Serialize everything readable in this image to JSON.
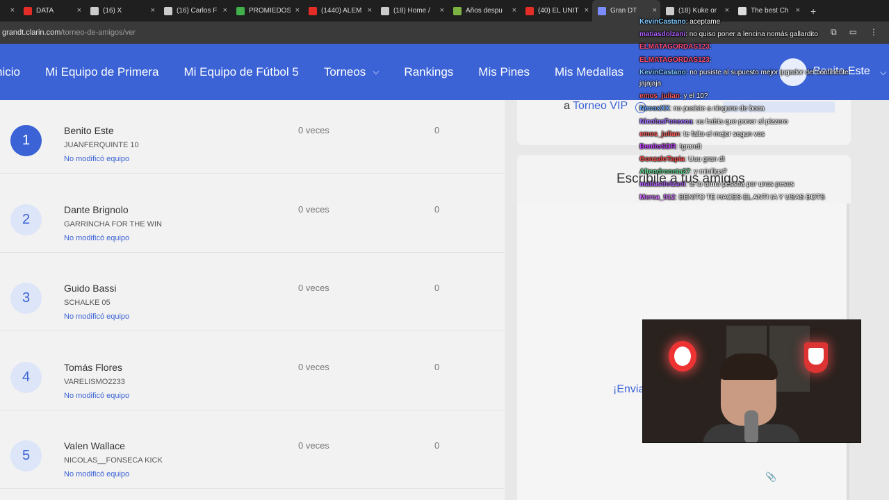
{
  "browser": {
    "tabs": [
      {
        "title": "",
        "icon_color": "#e52d27"
      },
      {
        "title": "DATA",
        "icon_color": "#e52d27"
      },
      {
        "title": "(16) X",
        "icon_color": "#cccccc"
      },
      {
        "title": "(16) Carlos F",
        "icon_color": "#cccccc"
      },
      {
        "title": "PROMIEDOS",
        "icon_color": "#3fb04a"
      },
      {
        "title": "(1440) ALEM",
        "icon_color": "#e52d27"
      },
      {
        "title": "(18) Home /",
        "icon_color": "#cccccc"
      },
      {
        "title": "Años despu",
        "icon_color": "#7cb342"
      },
      {
        "title": "(40) EL UNIT",
        "icon_color": "#e52d27"
      },
      {
        "title": "Gran DT",
        "icon_color": "#7b8cff"
      },
      {
        "title": "(18) Kuke or",
        "icon_color": "#cccccc"
      },
      {
        "title": "The best Ch",
        "icon_color": "#dddddd"
      }
    ],
    "new_tab": "+",
    "close_glyph": "×",
    "url_domain": "grandt.clarin.com",
    "url_path": "/torneo-de-amigos/ver"
  },
  "nav": {
    "items": [
      {
        "label": "nicio"
      },
      {
        "label": "Mi Equipo de Primera"
      },
      {
        "label": "Mi Equipo de Fútbol 5"
      },
      {
        "label": "Torneos",
        "chevron": true
      },
      {
        "label": "Rankings"
      },
      {
        "label": "Mis Pines"
      },
      {
        "label": "Mis Medallas"
      }
    ],
    "user_label": "Benito Este",
    "chevron_glyph": "⌵"
  },
  "ranking": [
    {
      "position": "1",
      "name": "Benito Este",
      "team": "JUANFERQUINTE 10",
      "status": "No modificó equipo",
      "changes": "0 veces",
      "points": "0"
    },
    {
      "position": "2",
      "name": "Dante Brignolo",
      "team": "GARRINCHA FOR THE WIN",
      "status": "No modificó equipo",
      "changes": "0 veces",
      "points": "0"
    },
    {
      "position": "3",
      "name": "Guido Bassi",
      "team": "SCHALKE 05",
      "status": "No modificó equipo",
      "changes": "0 veces",
      "points": "0"
    },
    {
      "position": "4",
      "name": "Tomás Flores",
      "team": "VARELISMO2233",
      "status": "No modificó equipo",
      "changes": "0 veces",
      "points": "0"
    },
    {
      "position": "5",
      "name": "Valen Wallace",
      "team": "NICOLAS__FONSECA KICK",
      "status": "No modificó equipo",
      "changes": "0 veces",
      "points": "0"
    }
  ],
  "sidebar": {
    "vip_prefix": "a",
    "vip_link": "Torneo VIP",
    "friends_title": "Escribile a tus amigos",
    "send_partial": "¡Envia"
  },
  "chat": [
    {
      "user": "KevinCastano",
      "text": ": aceptame",
      "color": "#7ec8ff"
    },
    {
      "user": "matiasdolzani",
      "text": ": no quiso poner a lencina nomás gallardito",
      "color": "#b060ff"
    },
    {
      "user": "ELMATAGORDAS123",
      "text": ":",
      "color": "#ff4d6d"
    },
    {
      "user": "ELMATAGORDAS123",
      "text": ":",
      "color": "#ff4d6d"
    },
    {
      "user": "KevinCastano",
      "text": ": no pusiste al supuesto mejor jugador del continente",
      "color": "#7ec8ff"
    },
    {
      "user": "",
      "text": "jajajaja",
      "color": "#ffffff"
    },
    {
      "user": "emos_julian",
      "text": ": y el 10?",
      "color": "#ff5a5a"
    },
    {
      "user": "NecoxXX",
      "text": ": no pusiste a ninguno de boca",
      "color": "#6aa8ff"
    },
    {
      "user": "NicolasFonseca",
      "text": ": uu habia que poner al pizzero",
      "color": "#a070ff"
    },
    {
      "user": "emos_julian",
      "text": ": te falto el mejor segun vos",
      "color": "#ff5a5a"
    },
    {
      "user": "BenitoSDR",
      "text": ": !grandt",
      "color": "#c040ff"
    },
    {
      "user": "GonzaloTapia",
      "text": ": Uuu gran dt",
      "color": "#ff4d4d"
    },
    {
      "user": "Altendroneta27",
      "text": ": y miniliga?",
      "color": "#5fd08a"
    },
    {
      "user": "matiasdolzani",
      "text": ": te lo armo pessoa por unos pesos",
      "color": "#b060ff"
    },
    {
      "user": "Merca_912",
      "text": ": BENITO TE HACES EL ANTI IA Y USAS BOTS",
      "color": "#d070ff"
    }
  ]
}
